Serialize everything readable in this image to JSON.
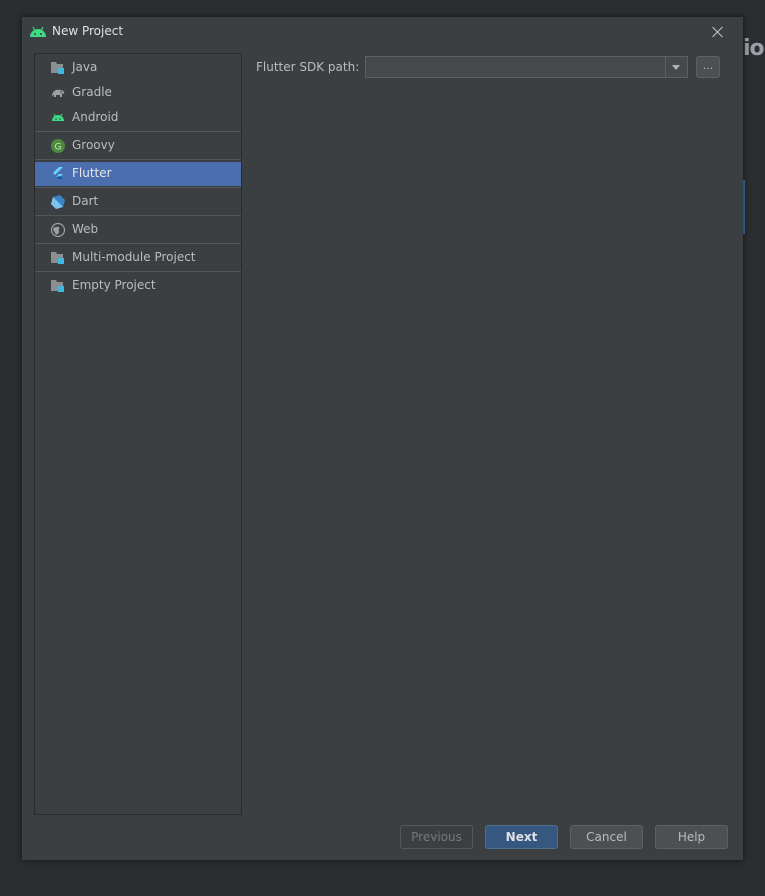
{
  "window": {
    "title": "New Project"
  },
  "background": {
    "peek_text": "io"
  },
  "sidebar": {
    "items": [
      {
        "label": "Java",
        "icon": "folder-module-icon"
      },
      {
        "label": "Gradle",
        "icon": "gradle-elephant-icon"
      },
      {
        "label": "Android",
        "icon": "android-icon"
      },
      {
        "label": "Groovy",
        "icon": "groovy-icon"
      },
      {
        "label": "Flutter",
        "icon": "flutter-icon",
        "selected": true
      },
      {
        "label": "Dart",
        "icon": "dart-icon"
      },
      {
        "label": "Web",
        "icon": "globe-icon"
      },
      {
        "label": "Multi-module Project",
        "icon": "folder-module-icon"
      },
      {
        "label": "Empty Project",
        "icon": "folder-module-icon"
      }
    ]
  },
  "form": {
    "sdk_label": "Flutter SDK path:",
    "sdk_value": "",
    "browse_label": "..."
  },
  "footer": {
    "previous": "Previous",
    "next": "Next",
    "cancel": "Cancel",
    "help": "Help"
  },
  "colors": {
    "dialog_bg": "#3c3f41",
    "selection": "#4b6eaf",
    "primary_button": "#365880",
    "android_green": "#3ddc84"
  }
}
